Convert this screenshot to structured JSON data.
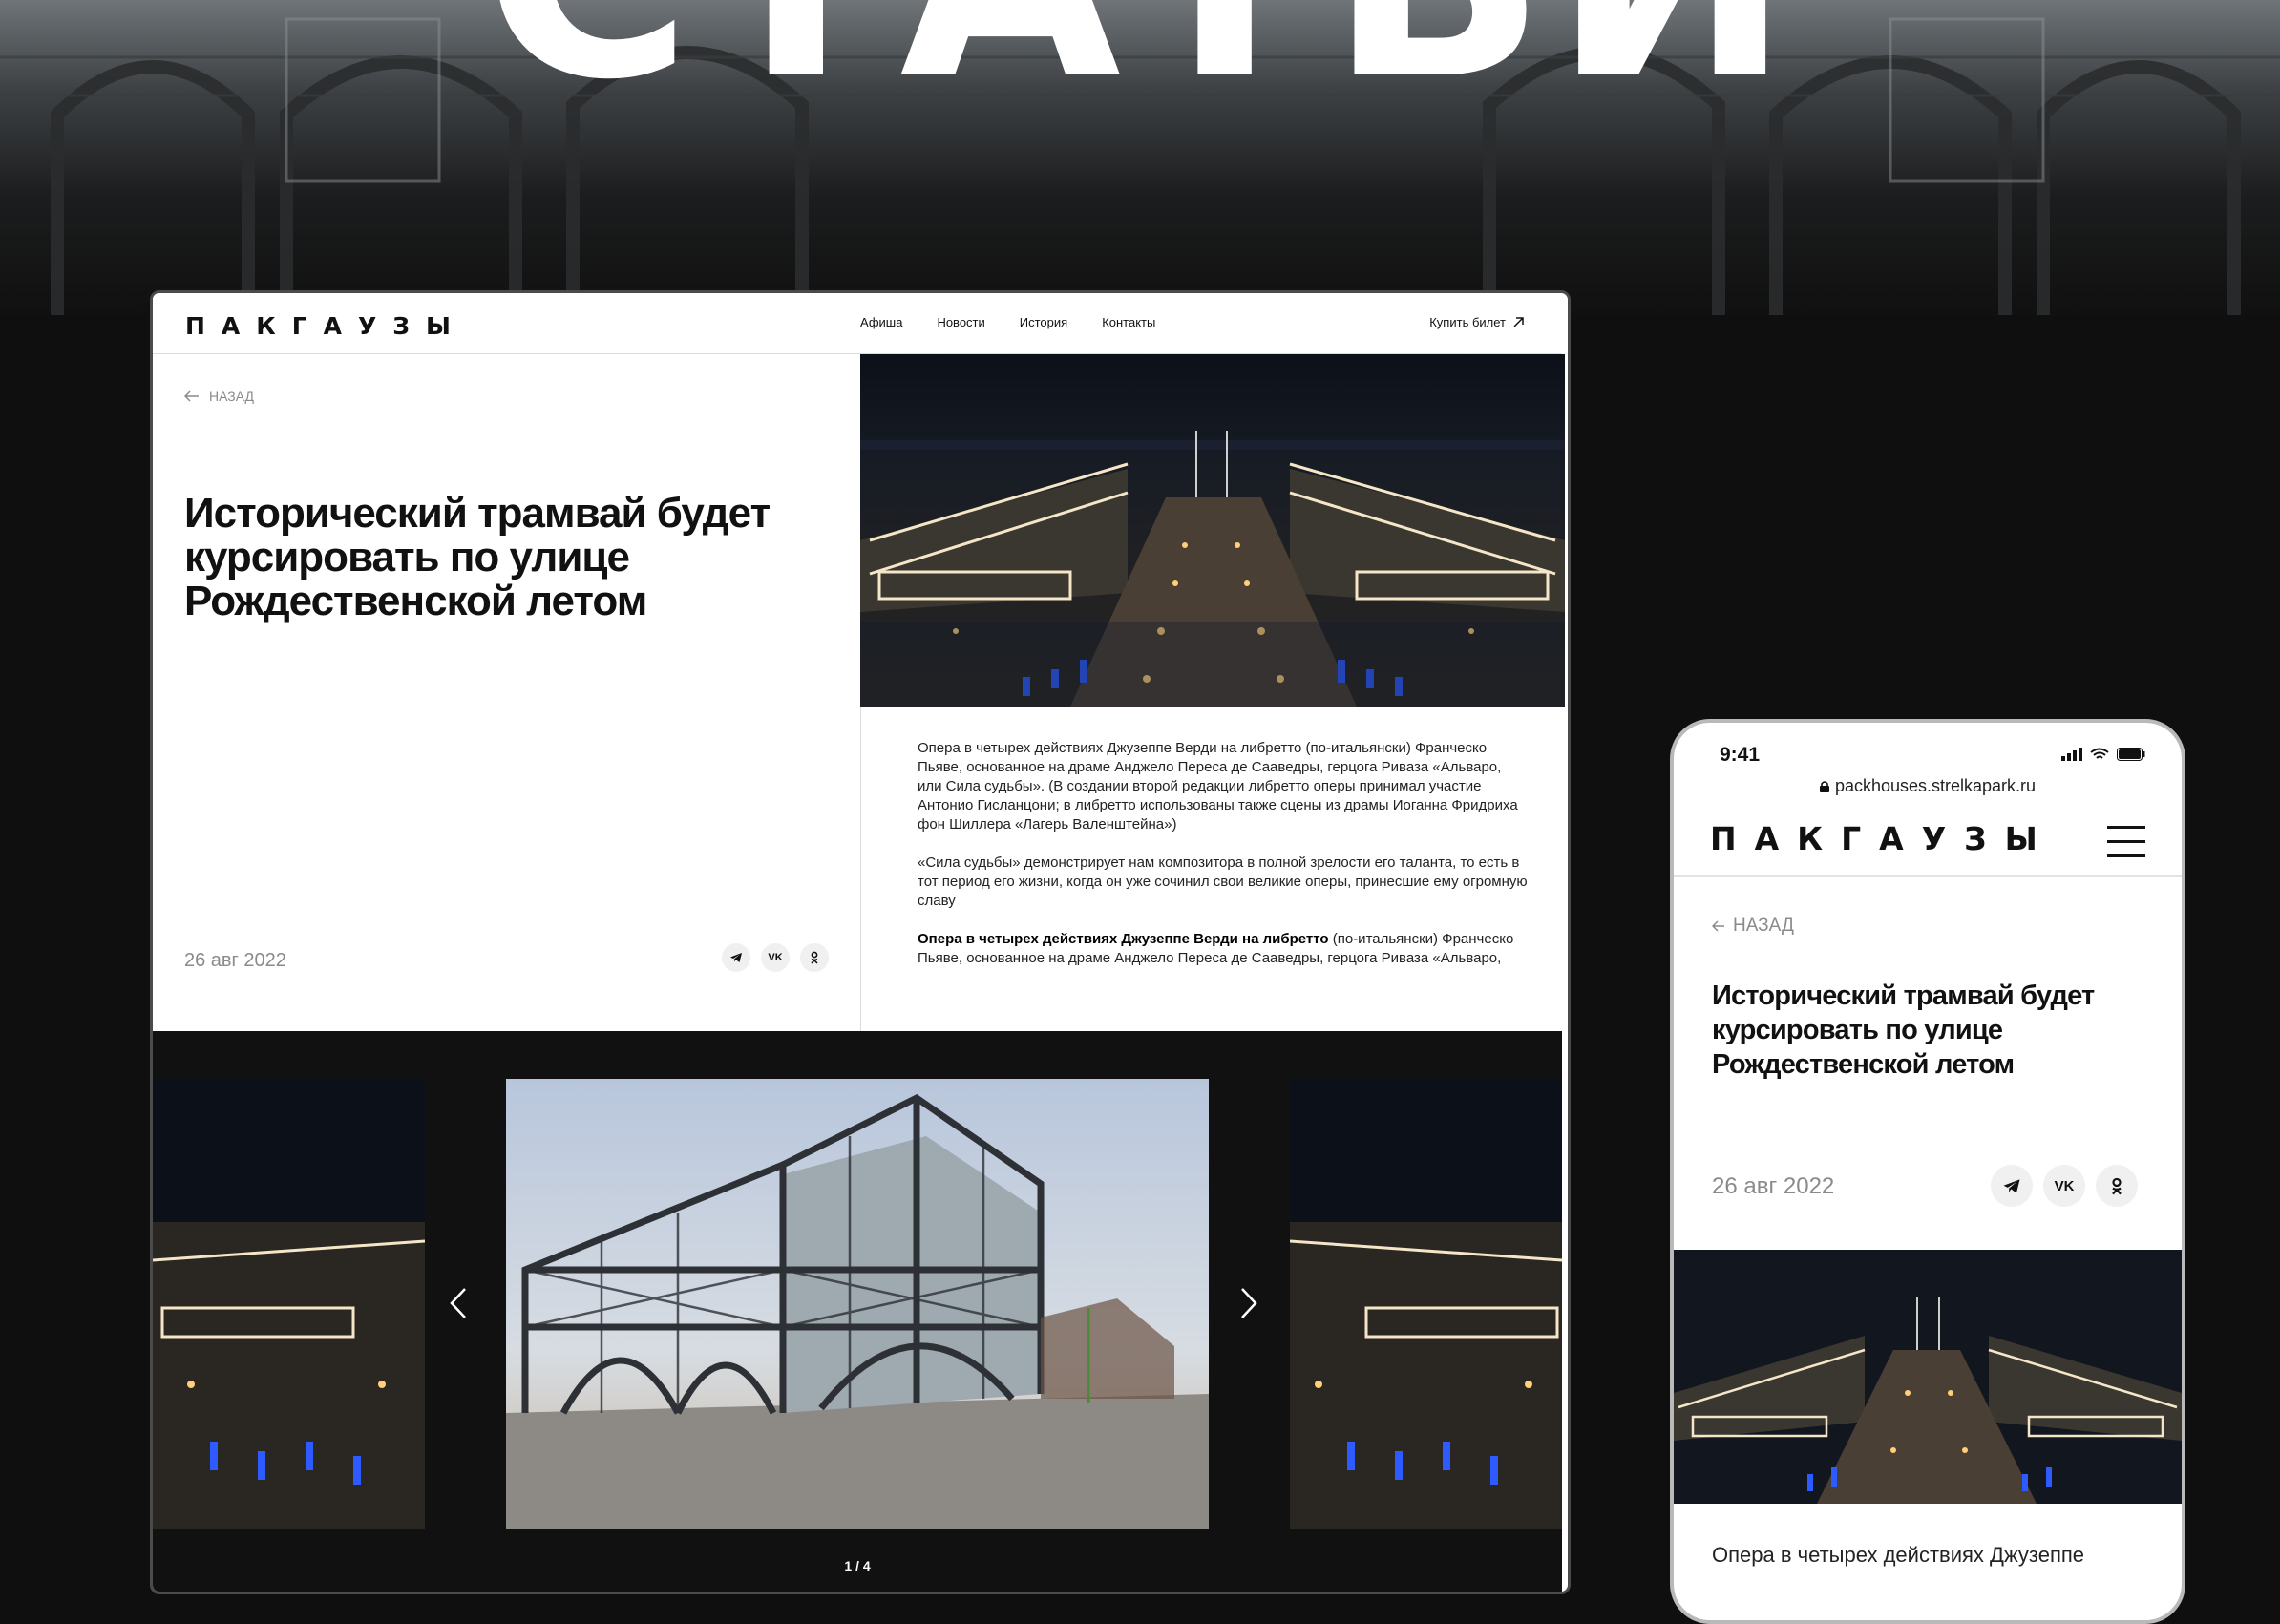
{
  "hero": {
    "title": "СТАТЬИ"
  },
  "desktop": {
    "logo": "ПАКГАУЗЫ",
    "nav": [
      "Афиша",
      "Новости",
      "История",
      "Контакты"
    ],
    "buy_ticket": "Купить билет",
    "back": "НАЗАД",
    "title": "Исторический трамвай будет курсировать по улице Рождественской летом",
    "date": "26 авг 2022",
    "share": [
      "telegram-icon",
      "vk-icon",
      "ok-icon"
    ],
    "share_labels": {
      "vk": "VK"
    },
    "paragraph1": "Опера в четырех действиях Джузеппе Верди на либретто (по-итальянски) Франческо Пьяве, основанное на драме Анджело Переса де Сааведры, герцога Риваза «Альваро, или Сила судьбы». (В создании второй редакции либретто оперы принимал участие Антонио Гисланцони; в либретто использованы также сцены из драмы Иоганна Фридриха фон Шиллера «Лагерь Валенштейна»)",
    "paragraph2": "«Сила судьбы» демонстрирует нам композитора в полной зрелости его таланта, то есть в тот период его жизни, когда он уже сочинил свои великие оперы, принесшие ему огромную славу",
    "paragraph3_bold": "Опера в четырех действиях Джузеппе Верди на либретто",
    "paragraph3_rest": " (по-итальянски) Франческо Пьяве, основанное на драме Анджело Переса де Сааведры, герцога Риваза «Альваро,",
    "gallery_counter": "1 / 4"
  },
  "mobile": {
    "time": "9:41",
    "url": "packhouses.strelkapark.ru",
    "logo": "ПАКГАУЗЫ",
    "back": "НАЗАД",
    "title": "Исторический трамвай будет курсировать по улице Рождественской летом",
    "date": "26 авг 2022",
    "text": "Опера в четырех действиях Джузеппе"
  },
  "colors": {
    "dark_bg": "#0f0f0f",
    "text_muted": "#8a8a8a",
    "accent_blue": "#2e5bff"
  }
}
